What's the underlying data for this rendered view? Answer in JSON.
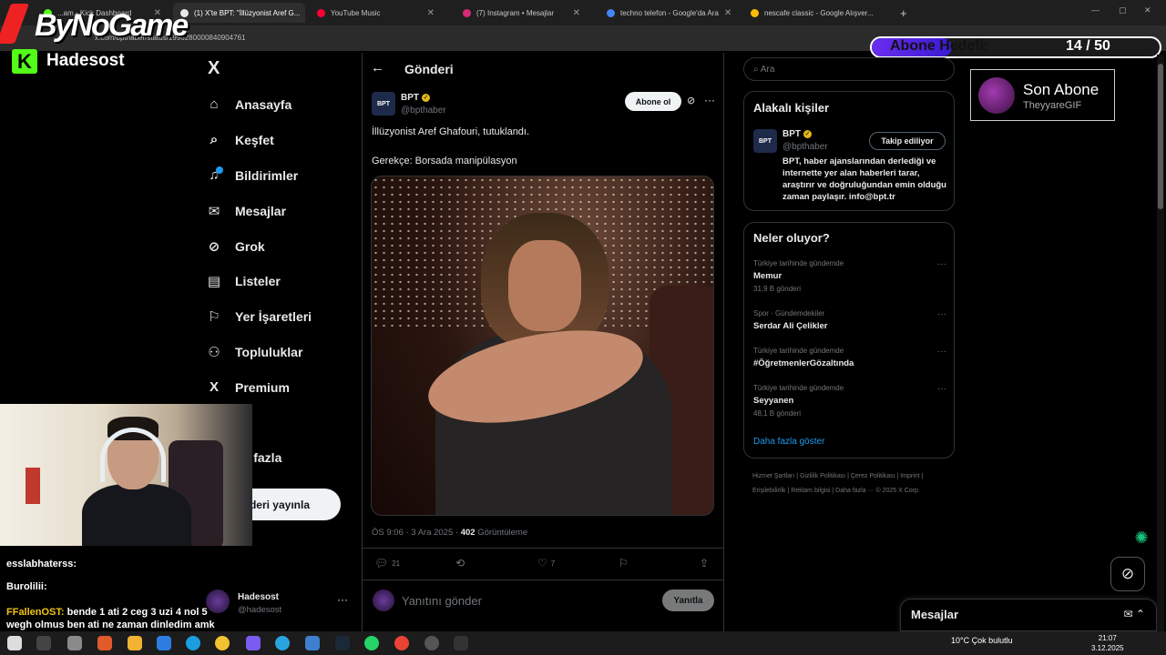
{
  "browser": {
    "tabs": [
      {
        "label": "...am - Kick Dashboard",
        "color": "#53fc18"
      },
      {
        "label": "(1) X'te BPT: \"İllüzyonist Aref G...",
        "color": "#e7e9ea",
        "active": true
      },
      {
        "label": "YouTube Music",
        "color": "#ff0033"
      },
      {
        "label": "(7) Instagram • Mesajlar",
        "color": "#d62976"
      },
      {
        "label": "techno telefon - Google'da Ara",
        "color": "#4285f4"
      },
      {
        "label": "nescafe classic - Google Alışver...",
        "color": "#fbbc05"
      }
    ],
    "new_tab": "+",
    "url": "x.com/bptnaber/status/1996280000840904761"
  },
  "overlay": {
    "brand": "ByNoGame",
    "kick_letter": "K",
    "kick_name": "Hadesost",
    "goal_label": "Abone Hedefi:",
    "goal_value": "14 / 50",
    "goal_current": 14,
    "goal_target": 50,
    "last_sub_title": "Son Abone",
    "last_sub_name": "TheyyareGIF"
  },
  "nav": {
    "logo": "X",
    "items": [
      {
        "label": "Anasayfa",
        "icon": "⌂"
      },
      {
        "label": "Keşfet",
        "icon": "⌕"
      },
      {
        "label": "Bildirimler",
        "icon": "♫"
      },
      {
        "label": "Mesajlar",
        "icon": "✉"
      },
      {
        "label": "Grok",
        "icon": "⊘"
      },
      {
        "label": "Listeler",
        "icon": "▤"
      },
      {
        "label": "Yer İşaretleri",
        "icon": "⚐"
      },
      {
        "label": "Topluluklar",
        "icon": "⚇"
      },
      {
        "label": "Premium",
        "icon": "X"
      },
      {
        "label": "fil",
        "icon": ""
      },
      {
        "label": "ha fazla",
        "icon": ""
      }
    ],
    "post_button": "deri yayınla",
    "user_name": "Hadesost",
    "user_handle": "@hadesost"
  },
  "chat": [
    {
      "user": "esslabhaterss:",
      "msg": "",
      "color": "#ffffff"
    },
    {
      "user": "Burolilii:",
      "msg": "",
      "color": "#ffffff"
    },
    {
      "user": "FFallenOST:",
      "msg": " bende 1 ati 2 ceg 3 uzi 4 nol 5",
      "color": "#f5c518"
    },
    {
      "user": "",
      "msg": "wegh olmus ben ati ne zaman dinledim amk",
      "color": "#ffffff"
    }
  ],
  "post": {
    "header": "Gönderi",
    "author_name": "BPT",
    "author_avatar": "BPT",
    "author_handle": "@bpthaber",
    "follow_label": "Abone ol",
    "text_line1": "İllüzyonist Aref Ghafouri, tutuklandı.",
    "text_line2": "Gerekçe: Borsada manipülasyon",
    "time": "ÖS 9:06 · 3 Ara 2025 · ",
    "views": "402",
    "views_label": " Görüntüleme",
    "replies": "21",
    "likes": "7",
    "reply_placeholder": "Yanıtını gönder",
    "reply_button": "Yanıtla"
  },
  "right": {
    "search_placeholder": "Ara",
    "related_title": "Alakalı kişiler",
    "related_name": "BPT",
    "related_handle": "@bpthaber",
    "related_follow": "Takip ediliyor",
    "related_bio": "BPT, haber ajanslarından derlediği ve internette yer alan haberleri tarar, araştırır ve doğruluğundan emin olduğu zaman paylaşır. info@bpt.tr",
    "trends_title": "Neler oluyor?",
    "trends": [
      {
        "context": "Türkiye tarihinde gündemde",
        "name": "Memur",
        "count": "31,9 B gönderi"
      },
      {
        "context": "Spor · Gündemdekiler",
        "name": "Serdar Ali Çelikler",
        "count": ""
      },
      {
        "context": "Türkiye tarihinde gündemde",
        "name": "#ÖğretmenlerGözaltında",
        "count": ""
      },
      {
        "context": "Türkiye tarihinde gündemde",
        "name": "Seyyanen",
        "count": "48,1 B gönderi"
      }
    ],
    "show_more": "Daha fazla göster",
    "footer": "Hizmet Şartları  |  Gizlilik Politikası  |  Çerez Politikası  |  Imprint  |  Erişilebilirlik  |  Reklam bilgisi  |  Daha fazla ···  © 2025 X Corp.",
    "messages_title": "Mesajlar"
  },
  "taskbar": {
    "weather": "10°C  Çok bulutlu",
    "time": "21:07",
    "date": "3.12.2025"
  }
}
